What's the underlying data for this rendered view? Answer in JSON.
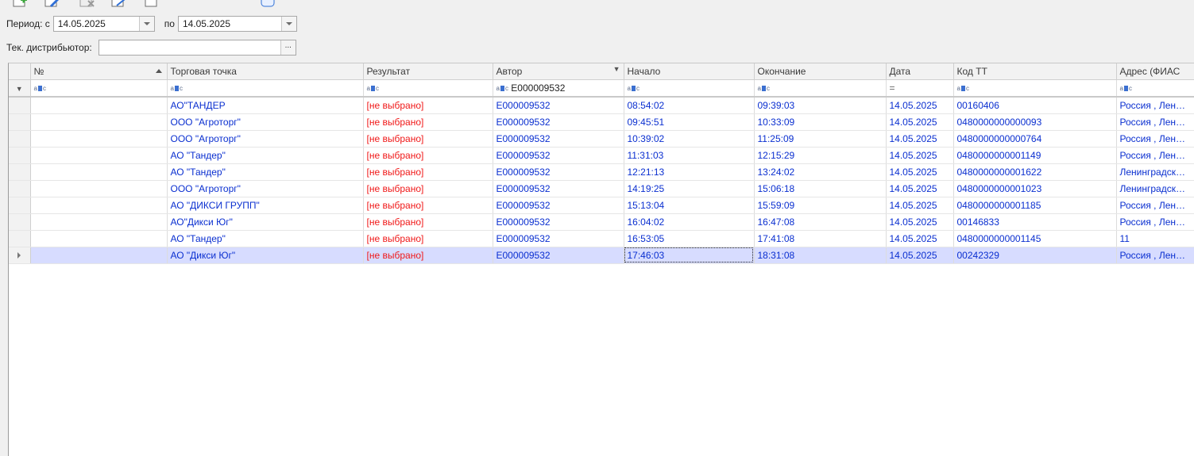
{
  "toolbar": {
    "icons": [
      "add-icon",
      "edit-icon",
      "delete-icon",
      "check-icon",
      "document-icon",
      "refresh-icon"
    ]
  },
  "filters": {
    "period_from_label": "Период: с",
    "period_from_value": "14.05.2025",
    "period_to_label": "по",
    "period_to_value": "14.05.2025",
    "distributor_label": "Тек. дистрибьютор:",
    "distributor_value": "",
    "ellipsis": "..."
  },
  "grid": {
    "columns": [
      "№",
      "Торговая точка",
      "Результат",
      "Автор",
      "Начало",
      "Окончание",
      "Дата",
      "Код ТТ",
      "Адрес (ФИАС"
    ],
    "filter_row": {
      "abc": "abc",
      "author_filter": "E000009532",
      "date_filter": "="
    },
    "rows": [
      {
        "num": "",
        "outlet": "АО\"ТАНДЕР",
        "result": "[не выбрано]",
        "author": "E000009532",
        "start": "08:54:02",
        "end": "09:39:03",
        "date": "14.05.2025",
        "code": "00160406",
        "address": "Россия , Лен…"
      },
      {
        "num": "",
        "outlet": "ООО \"Агроторг\"",
        "result": "[не выбрано]",
        "author": "E000009532",
        "start": "09:45:51",
        "end": "10:33:09",
        "date": "14.05.2025",
        "code": "0480000000000093",
        "address": "Россия , Лен…"
      },
      {
        "num": "",
        "outlet": "ООО \"Агроторг\"",
        "result": "[не выбрано]",
        "author": "E000009532",
        "start": "10:39:02",
        "end": "11:25:09",
        "date": "14.05.2025",
        "code": "0480000000000764",
        "address": "Россия , Лен…"
      },
      {
        "num": "",
        "outlet": "АО \"Тандер\"",
        "result": "[не выбрано]",
        "author": "E000009532",
        "start": "11:31:03",
        "end": "12:15:29",
        "date": "14.05.2025",
        "code": "0480000000001149",
        "address": "Россия , Лен…"
      },
      {
        "num": "",
        "outlet": "АО \"Тандер\"",
        "result": "[не выбрано]",
        "author": "E000009532",
        "start": "12:21:13",
        "end": "13:24:02",
        "date": "14.05.2025",
        "code": "0480000000001622",
        "address": "Ленинградск…"
      },
      {
        "num": "",
        "outlet": "ООО \"Агроторг\"",
        "result": "[не выбрано]",
        "author": "E000009532",
        "start": "14:19:25",
        "end": "15:06:18",
        "date": "14.05.2025",
        "code": "0480000000001023",
        "address": "Ленинградск…"
      },
      {
        "num": "",
        "outlet": "АО \"ДИКСИ ГРУПП\"",
        "result": "[не выбрано]",
        "author": "E000009532",
        "start": "15:13:04",
        "end": "15:59:09",
        "date": "14.05.2025",
        "code": "0480000000001185",
        "address": "Россия , Лен…"
      },
      {
        "num": "",
        "outlet": "АО\"Дикси Юг\"",
        "result": "[не выбрано]",
        "author": "E000009532",
        "start": "16:04:02",
        "end": "16:47:08",
        "date": "14.05.2025",
        "code": "00146833",
        "address": "Россия , Лен…"
      },
      {
        "num": "",
        "outlet": "АО \"Тандер\"",
        "result": "[не выбрано]",
        "author": "E000009532",
        "start": "16:53:05",
        "end": "17:41:08",
        "date": "14.05.2025",
        "code": "0480000000001145",
        "address": "11"
      },
      {
        "num": "",
        "outlet": "АО \"Дикси Юг\"",
        "result": "[не выбрано]",
        "author": "E000009532",
        "start": "17:46:03",
        "end": "18:31:08",
        "date": "14.05.2025",
        "code": "00242329",
        "address": "Россия , Лен…"
      }
    ],
    "selected_row": 9
  }
}
